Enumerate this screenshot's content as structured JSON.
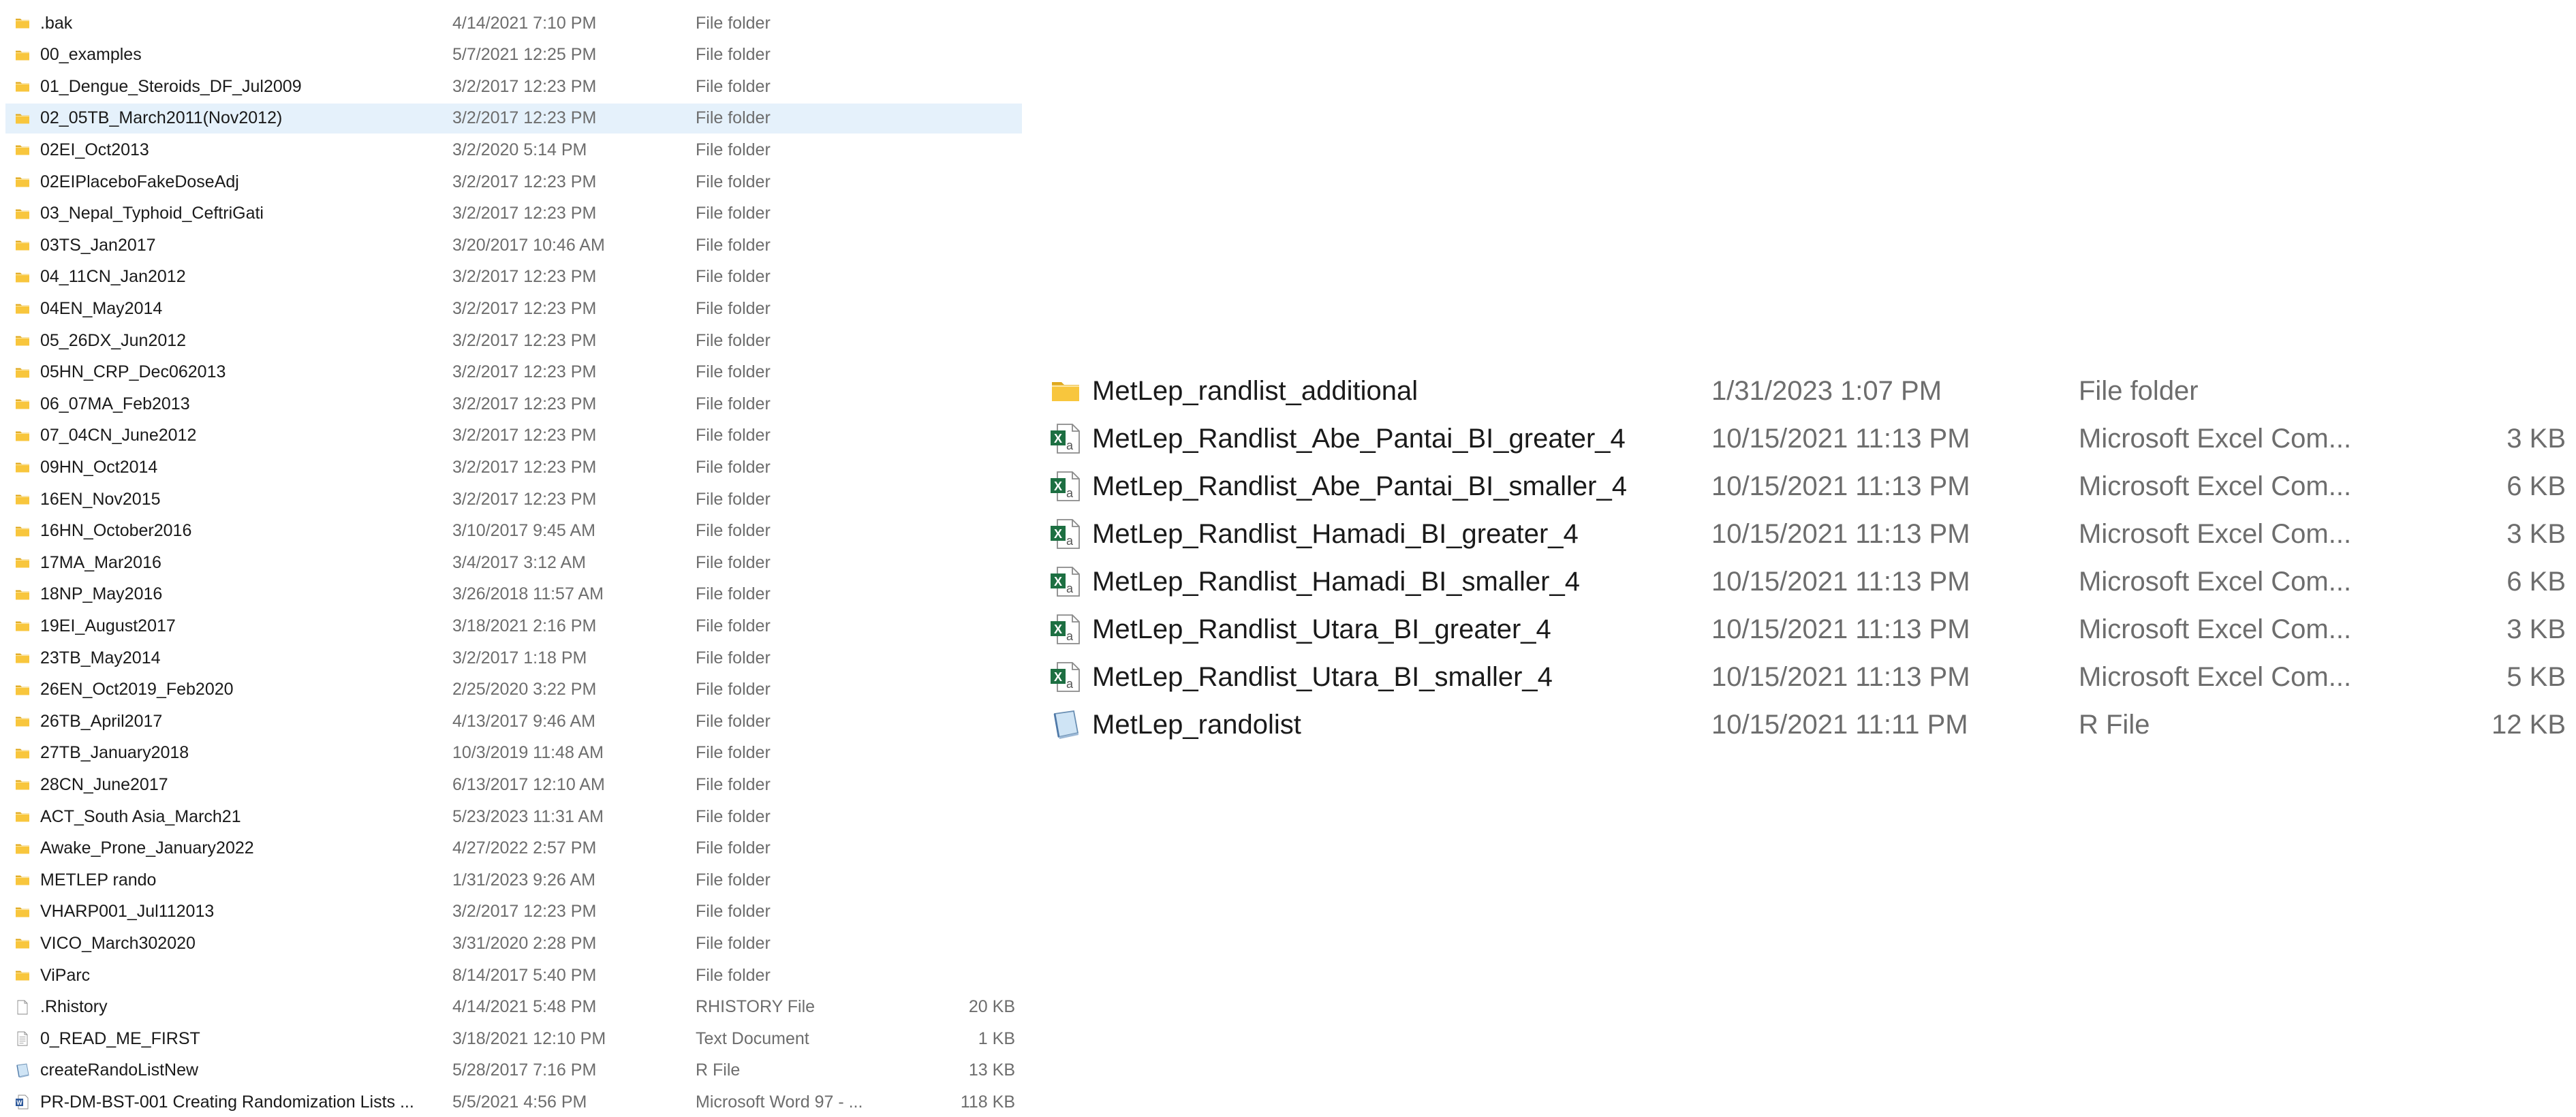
{
  "left_list": {
    "items": [
      {
        "name": ".bak",
        "date": "4/14/2021 7:10 PM",
        "type": "File folder",
        "size": "",
        "icon": "folder-icon"
      },
      {
        "name": "00_examples",
        "date": "5/7/2021 12:25 PM",
        "type": "File folder",
        "size": "",
        "icon": "folder-icon"
      },
      {
        "name": "01_Dengue_Steroids_DF_Jul2009",
        "date": "3/2/2017 12:23 PM",
        "type": "File folder",
        "size": "",
        "icon": "folder-icon"
      },
      {
        "name": "02_05TB_March2011(Nov2012)",
        "date": "3/2/2017 12:23 PM",
        "type": "File folder",
        "size": "",
        "icon": "folder-icon",
        "selected": true
      },
      {
        "name": "02EI_Oct2013",
        "date": "3/2/2020 5:14 PM",
        "type": "File folder",
        "size": "",
        "icon": "folder-icon"
      },
      {
        "name": "02EIPlaceboFakeDoseAdj",
        "date": "3/2/2017 12:23 PM",
        "type": "File folder",
        "size": "",
        "icon": "folder-icon"
      },
      {
        "name": "03_Nepal_Typhoid_CeftriGati",
        "date": "3/2/2017 12:23 PM",
        "type": "File folder",
        "size": "",
        "icon": "folder-icon"
      },
      {
        "name": "03TS_Jan2017",
        "date": "3/20/2017 10:46 AM",
        "type": "File folder",
        "size": "",
        "icon": "folder-icon"
      },
      {
        "name": "04_11CN_Jan2012",
        "date": "3/2/2017 12:23 PM",
        "type": "File folder",
        "size": "",
        "icon": "folder-icon"
      },
      {
        "name": "04EN_May2014",
        "date": "3/2/2017 12:23 PM",
        "type": "File folder",
        "size": "",
        "icon": "folder-icon"
      },
      {
        "name": "05_26DX_Jun2012",
        "date": "3/2/2017 12:23 PM",
        "type": "File folder",
        "size": "",
        "icon": "folder-icon"
      },
      {
        "name": "05HN_CRP_Dec062013",
        "date": "3/2/2017 12:23 PM",
        "type": "File folder",
        "size": "",
        "icon": "folder-icon"
      },
      {
        "name": "06_07MA_Feb2013",
        "date": "3/2/2017 12:23 PM",
        "type": "File folder",
        "size": "",
        "icon": "folder-icon"
      },
      {
        "name": "07_04CN_June2012",
        "date": "3/2/2017 12:23 PM",
        "type": "File folder",
        "size": "",
        "icon": "folder-icon"
      },
      {
        "name": "09HN_Oct2014",
        "date": "3/2/2017 12:23 PM",
        "type": "File folder",
        "size": "",
        "icon": "folder-icon"
      },
      {
        "name": "16EN_Nov2015",
        "date": "3/2/2017 12:23 PM",
        "type": "File folder",
        "size": "",
        "icon": "folder-icon"
      },
      {
        "name": "16HN_October2016",
        "date": "3/10/2017 9:45 AM",
        "type": "File folder",
        "size": "",
        "icon": "folder-icon"
      },
      {
        "name": "17MA_Mar2016",
        "date": "3/4/2017 3:12 AM",
        "type": "File folder",
        "size": "",
        "icon": "folder-icon"
      },
      {
        "name": "18NP_May2016",
        "date": "3/26/2018 11:57 AM",
        "type": "File folder",
        "size": "",
        "icon": "folder-icon"
      },
      {
        "name": "19EI_August2017",
        "date": "3/18/2021 2:16 PM",
        "type": "File folder",
        "size": "",
        "icon": "folder-icon"
      },
      {
        "name": "23TB_May2014",
        "date": "3/2/2017 1:18 PM",
        "type": "File folder",
        "size": "",
        "icon": "folder-icon"
      },
      {
        "name": "26EN_Oct2019_Feb2020",
        "date": "2/25/2020 3:22 PM",
        "type": "File folder",
        "size": "",
        "icon": "folder-icon"
      },
      {
        "name": "26TB_April2017",
        "date": "4/13/2017 9:46 AM",
        "type": "File folder",
        "size": "",
        "icon": "folder-icon"
      },
      {
        "name": "27TB_January2018",
        "date": "10/3/2019 11:48 AM",
        "type": "File folder",
        "size": "",
        "icon": "folder-icon"
      },
      {
        "name": "28CN_June2017",
        "date": "6/13/2017 12:10 AM",
        "type": "File folder",
        "size": "",
        "icon": "folder-icon"
      },
      {
        "name": "ACT_South Asia_March21",
        "date": "5/23/2023 11:31 AM",
        "type": "File folder",
        "size": "",
        "icon": "folder-icon"
      },
      {
        "name": "Awake_Prone_January2022",
        "date": "4/27/2022 2:57 PM",
        "type": "File folder",
        "size": "",
        "icon": "folder-icon"
      },
      {
        "name": "METLEP rando",
        "date": "1/31/2023 9:26 AM",
        "type": "File folder",
        "size": "",
        "icon": "folder-icon"
      },
      {
        "name": "VHARP001_Jul112013",
        "date": "3/2/2017 12:23 PM",
        "type": "File folder",
        "size": "",
        "icon": "folder-icon"
      },
      {
        "name": "VICO_March302020",
        "date": "3/31/2020 2:28 PM",
        "type": "File folder",
        "size": "",
        "icon": "folder-icon"
      },
      {
        "name": "ViParc",
        "date": "8/14/2017 5:40 PM",
        "type": "File folder",
        "size": "",
        "icon": "folder-icon"
      },
      {
        "name": ".Rhistory",
        "date": "4/14/2021 5:48 PM",
        "type": "RHISTORY File",
        "size": "20 KB",
        "icon": "blank-file-icon"
      },
      {
        "name": "0_READ_ME_FIRST",
        "date": "3/18/2021 12:10 PM",
        "type": "Text Document",
        "size": "1 KB",
        "icon": "text-file-icon"
      },
      {
        "name": "createRandoListNew",
        "date": "5/28/2017 7:16 PM",
        "type": "R File",
        "size": "13 KB",
        "icon": "r-file-icon"
      },
      {
        "name": "PR-DM-BST-001 Creating Randomization Lists ...",
        "date": "5/5/2021 4:56 PM",
        "type": "Microsoft Word 97 - ...",
        "size": "118 KB",
        "icon": "word-file-icon"
      }
    ]
  },
  "right_list": {
    "items": [
      {
        "name": "MetLep_randlist_additional",
        "date": "1/31/2023 1:07 PM",
        "type": "File folder",
        "size": "",
        "icon": "folder-icon"
      },
      {
        "name": "MetLep_Randlist_Abe_Pantai_BI_greater_4",
        "date": "10/15/2021 11:13 PM",
        "type": "Microsoft Excel Com...",
        "size": "3 KB",
        "icon": "excel-file-icon"
      },
      {
        "name": "MetLep_Randlist_Abe_Pantai_BI_smaller_4",
        "date": "10/15/2021 11:13 PM",
        "type": "Microsoft Excel Com...",
        "size": "6 KB",
        "icon": "excel-file-icon"
      },
      {
        "name": "MetLep_Randlist_Hamadi_BI_greater_4",
        "date": "10/15/2021 11:13 PM",
        "type": "Microsoft Excel Com...",
        "size": "3 KB",
        "icon": "excel-file-icon"
      },
      {
        "name": "MetLep_Randlist_Hamadi_BI_smaller_4",
        "date": "10/15/2021 11:13 PM",
        "type": "Microsoft Excel Com...",
        "size": "6 KB",
        "icon": "excel-file-icon"
      },
      {
        "name": "MetLep_Randlist_Utara_BI_greater_4",
        "date": "10/15/2021 11:13 PM",
        "type": "Microsoft Excel Com...",
        "size": "3 KB",
        "icon": "excel-file-icon"
      },
      {
        "name": "MetLep_Randlist_Utara_BI_smaller_4",
        "date": "10/15/2021 11:13 PM",
        "type": "Microsoft Excel Com...",
        "size": "5 KB",
        "icon": "excel-file-icon"
      },
      {
        "name": "MetLep_randolist",
        "date": "10/15/2021 11:11 PM",
        "type": "R File",
        "size": "12 KB",
        "icon": "r-file-icon"
      }
    ]
  },
  "colors": {
    "selection": "#e5f1fb",
    "folder_yellow": "#f8c63d",
    "excel_green": "#1d6f42",
    "secondary_text": "#6d6d6d"
  }
}
